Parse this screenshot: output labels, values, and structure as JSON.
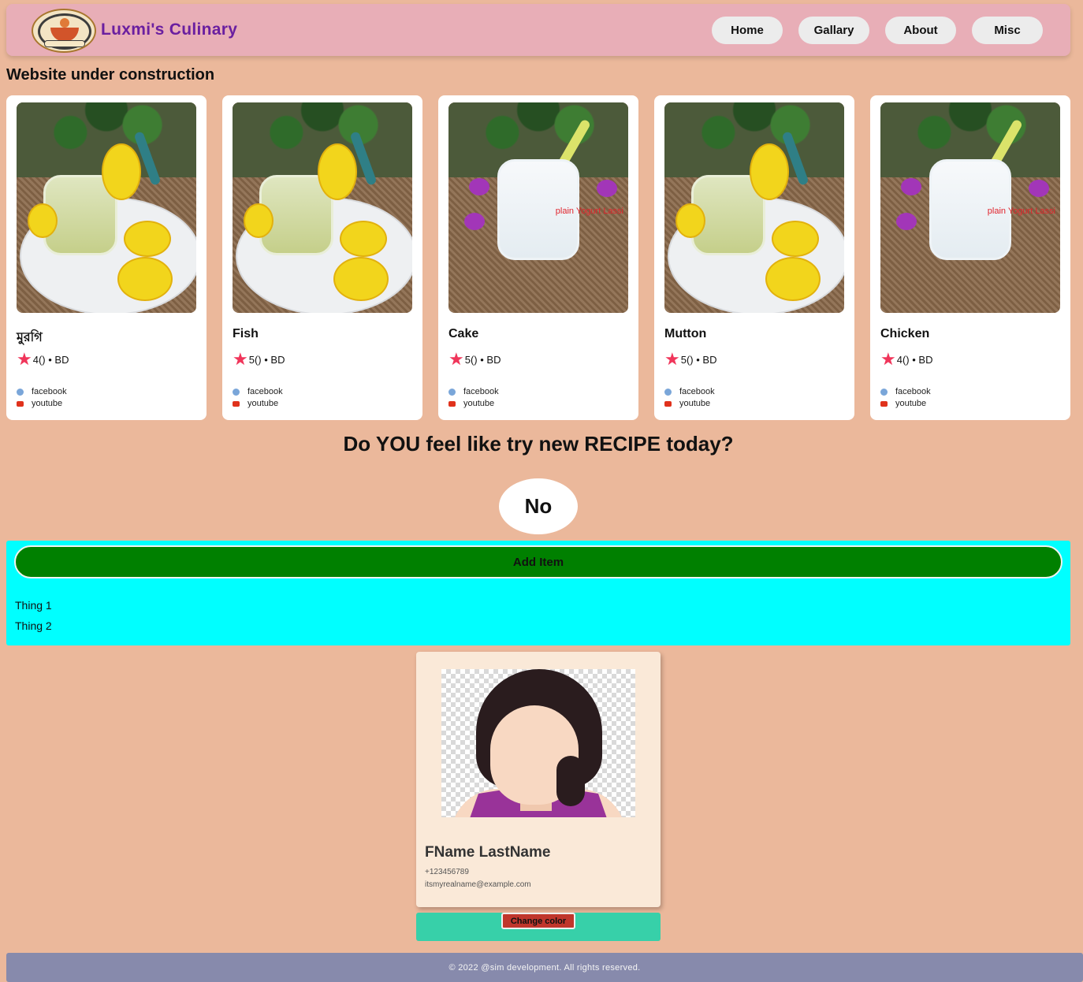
{
  "header": {
    "brand": "Luxmi's Culinary",
    "logo_text": "Luxmi's Culinary",
    "nav": [
      "Home",
      "Gallary",
      "About",
      "Misc"
    ]
  },
  "notice": "Website under construction",
  "cards": [
    {
      "title": "মুরগি",
      "rating": "4()",
      "region": "BD",
      "photo": "pineapple-lassi",
      "facebook": "facebook",
      "youtube": "youtube"
    },
    {
      "title": "Fish",
      "rating": "5()",
      "region": "BD",
      "photo": "pineapple-lassi",
      "facebook": "facebook",
      "youtube": "youtube"
    },
    {
      "title": "Cake",
      "rating": "5()",
      "region": "BD",
      "photo": "plain-yogurt-lassi",
      "overlay": "plain Yogurt Lassi",
      "facebook": "facebook",
      "youtube": "youtube"
    },
    {
      "title": "Mutton",
      "rating": "5()",
      "region": "BD",
      "photo": "pineapple-lassi",
      "facebook": "facebook",
      "youtube": "youtube"
    },
    {
      "title": "Chicken",
      "rating": "4()",
      "region": "BD",
      "photo": "plain-yogurt-lassi",
      "overlay": "plain Yogurt Lassi",
      "facebook": "facebook",
      "youtube": "youtube"
    }
  ],
  "question": "Do YOU feel like try new RECIPE today?",
  "no_button": "No",
  "list_panel": {
    "add_button": "Add Item",
    "items": [
      "Thing 1",
      "Thing 2"
    ]
  },
  "profile": {
    "name": "FName LastName",
    "phone": "+123456789",
    "email": "itsmyrealname@example.com"
  },
  "change_color_button": "Change color",
  "footer": "© 2022 @sim development. All rights reserved.",
  "colors": {
    "background": "#ebb89b",
    "header": "#e8aeb7",
    "brand": "#6a1fa0",
    "star": "#f0355a",
    "panel": "#00ffff",
    "add_button": "#008000",
    "color_bar": "#37d0a9",
    "change_color_button": "#c0362c",
    "footer": "#878aac"
  }
}
